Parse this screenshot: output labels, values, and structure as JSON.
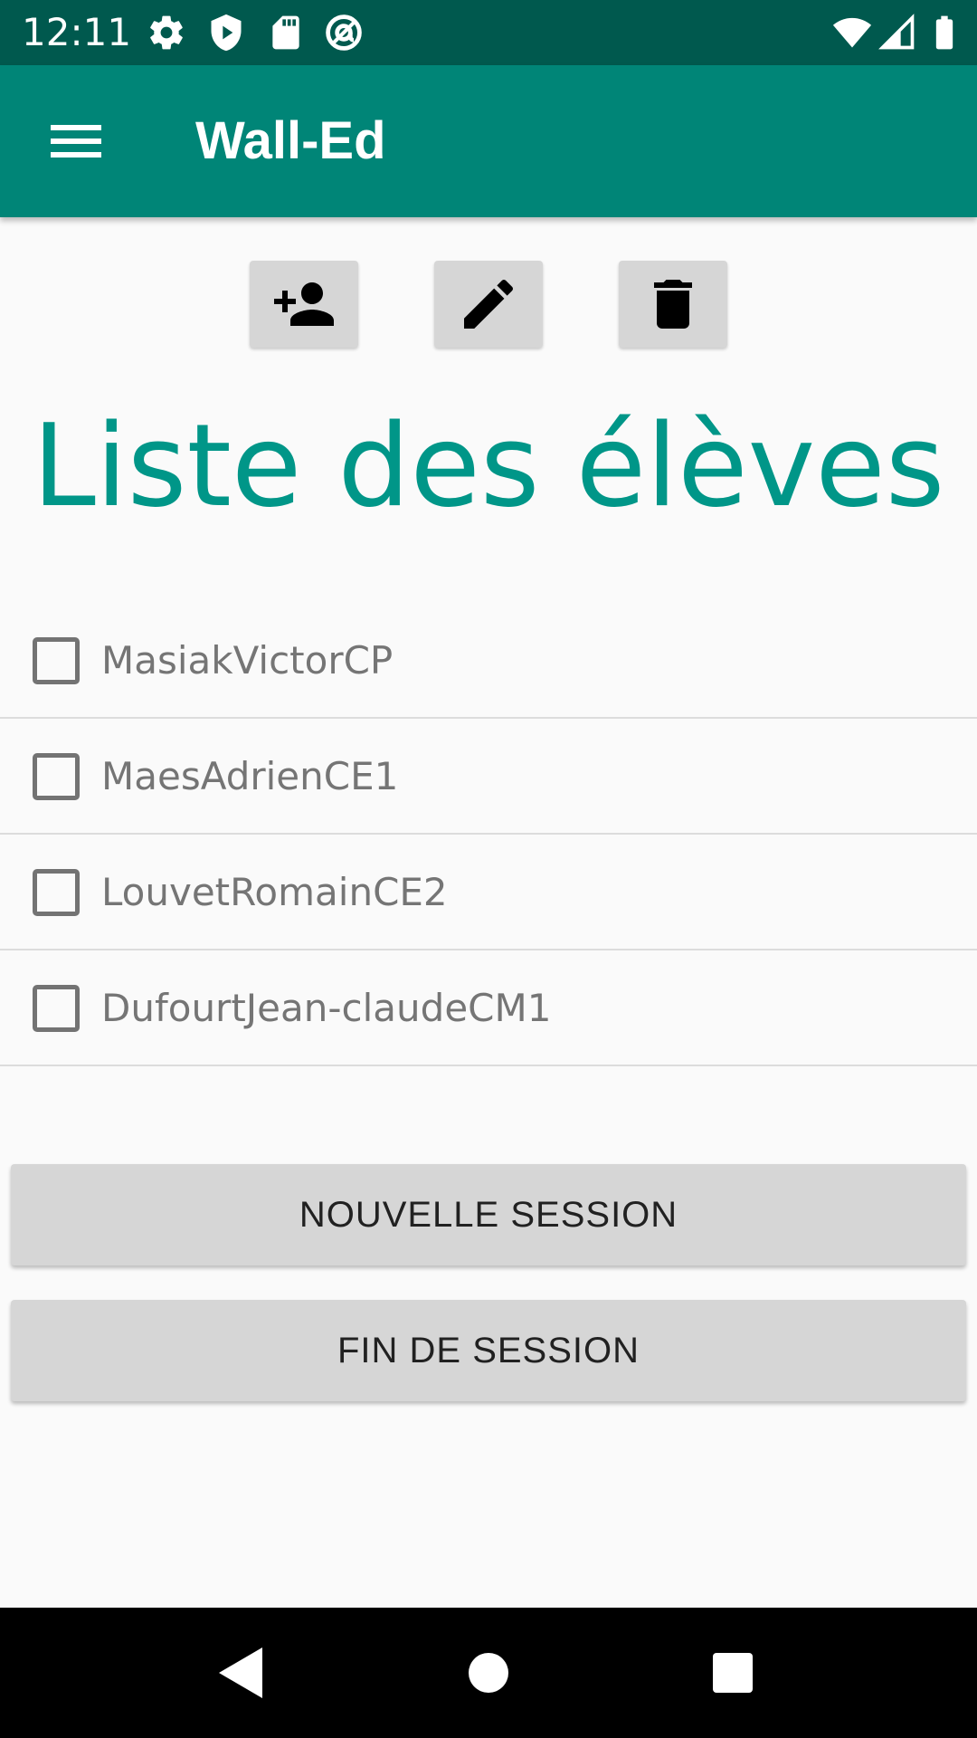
{
  "status_bar": {
    "time": "12:11",
    "left_icons": [
      "settings-icon",
      "shield-icon",
      "sd-card-icon",
      "vpn-at-icon"
    ],
    "right_icons": [
      "wifi-icon",
      "cell-signal-icon",
      "battery-icon"
    ]
  },
  "app_bar": {
    "title": "Wall-Ed",
    "menu_icon": "hamburger-menu-icon",
    "color": "#008577"
  },
  "actions": [
    {
      "name": "add-student-button",
      "icon": "person-add-icon"
    },
    {
      "name": "edit-student-button",
      "icon": "edit-pencil-icon"
    },
    {
      "name": "delete-student-button",
      "icon": "trash-icon"
    }
  ],
  "list": {
    "title": "Liste des élèves",
    "title_color": "#009688",
    "students": [
      {
        "name": "MasiakVictorCP",
        "checked": false
      },
      {
        "name": "MaesAdrienCE1",
        "checked": false
      },
      {
        "name": "LouvetRomainCE2",
        "checked": false
      },
      {
        "name": "DufourtJean-claudeCM1",
        "checked": false
      }
    ]
  },
  "session": {
    "new_label": "NOUVELLE SESSION",
    "end_label": "FIN DE SESSION"
  },
  "nav_bar": {
    "icons": [
      "back-icon",
      "home-icon",
      "recents-icon"
    ]
  }
}
